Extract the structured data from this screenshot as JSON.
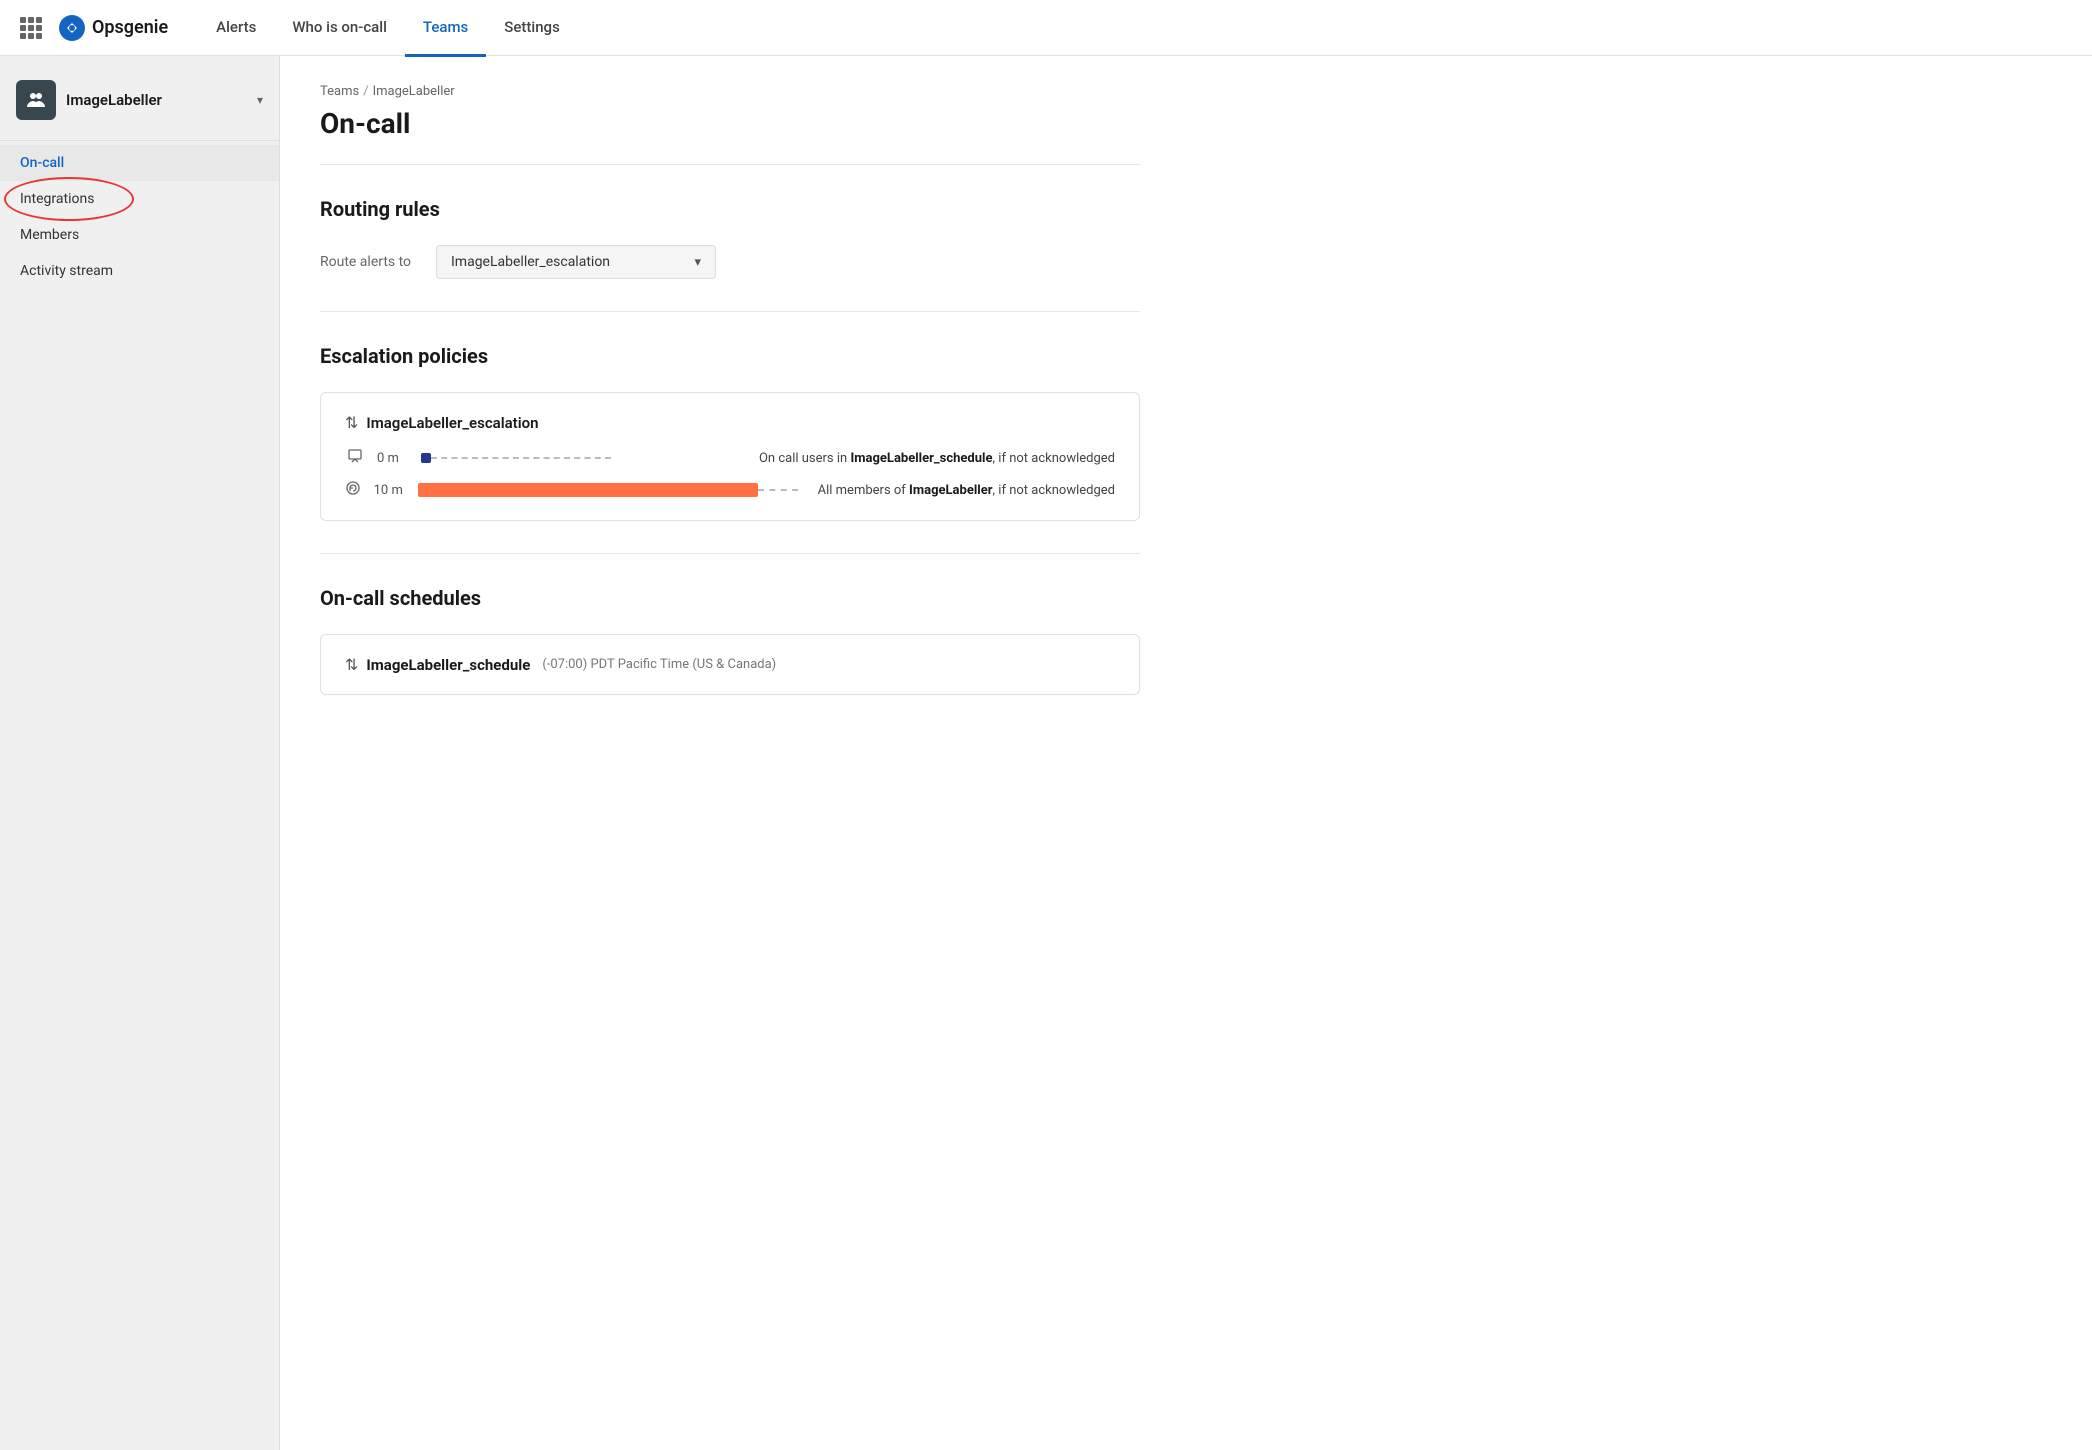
{
  "nav": {
    "logo_text": "Opsgenie",
    "links": [
      {
        "label": "Alerts",
        "active": false
      },
      {
        "label": "Who is on-call",
        "active": false
      },
      {
        "label": "Teams",
        "active": true
      },
      {
        "label": "Settings",
        "active": false
      }
    ]
  },
  "sidebar": {
    "team_name": "ImageLabeller",
    "items": [
      {
        "label": "On-call",
        "active": true,
        "id": "on-call"
      },
      {
        "label": "Integrations",
        "active": false,
        "id": "integrations"
      },
      {
        "label": "Members",
        "active": false,
        "id": "members"
      },
      {
        "label": "Activity stream",
        "active": false,
        "id": "activity-stream"
      }
    ]
  },
  "breadcrumb": {
    "parent": "Teams",
    "current": "ImageLabeller"
  },
  "page": {
    "title": "On-call"
  },
  "routing_rules": {
    "section_title": "Routing rules",
    "label": "Route alerts to",
    "selected_value": "ImageLabeller_escalation"
  },
  "escalation_policies": {
    "section_title": "Escalation policies",
    "policy": {
      "name": "ImageLabeller_escalation",
      "rows": [
        {
          "type": "notification",
          "time": "0 m",
          "description_pre": "On call users in ",
          "description_bold": "ImageLabeller_schedule",
          "description_post": ", if not acknowledged"
        },
        {
          "type": "repeat",
          "time": "10 m",
          "description_pre": "All members of ",
          "description_bold": "ImageLabeller",
          "description_post": ", if not acknowledged"
        }
      ]
    }
  },
  "on_call_schedules": {
    "section_title": "On-call schedules",
    "schedule": {
      "name": "ImageLabeller_schedule",
      "timezone": "(-07:00) PDT Pacific Time (US & Canada)"
    }
  }
}
